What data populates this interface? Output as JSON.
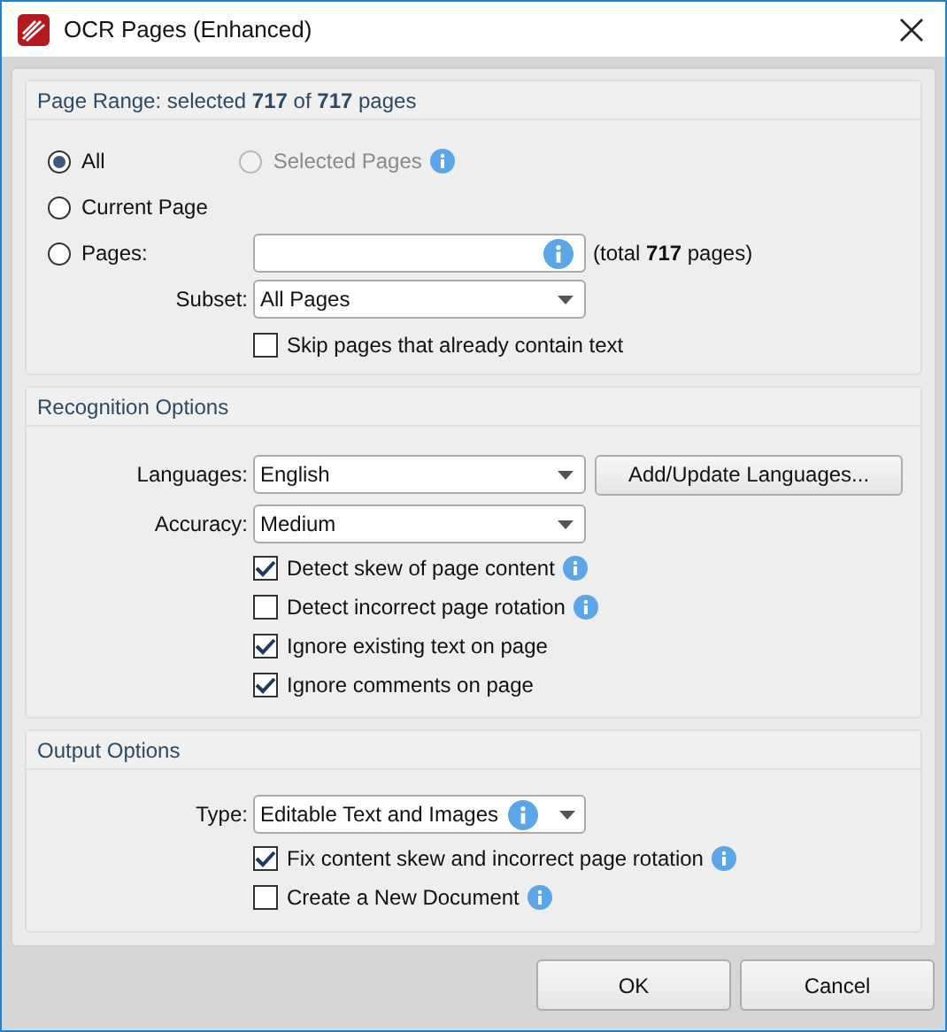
{
  "window": {
    "title": "OCR Pages (Enhanced)"
  },
  "page_range": {
    "title": "Page Range: selected **717** of **717** pages",
    "all": {
      "label": "All",
      "selected": true,
      "disabled": false
    },
    "selected_pages": {
      "label": "Selected Pages",
      "selected": false,
      "disabled": true,
      "info": true
    },
    "current_page": {
      "label": "Current Page",
      "selected": false,
      "disabled": false
    },
    "pages": {
      "label": "Pages:",
      "selected": false,
      "disabled": false,
      "info": true,
      "total": "(total **717** pages)"
    },
    "subset": {
      "label": "Subset:",
      "value": "All Pages"
    },
    "checkboxes": [
      {
        "label": "Skip pages that already contain text",
        "checked": false,
        "info": false
      }
    ]
  },
  "recognition": {
    "title": "Recognition Options",
    "languages": {
      "label": "Languages:",
      "value": "English",
      "button": "Add/Update Languages..."
    },
    "accuracy": {
      "label": "Accuracy:",
      "value": "Medium"
    },
    "checkboxes": [
      {
        "label": "Detect skew of page content",
        "checked": true,
        "info": true
      },
      {
        "label": "Detect incorrect page rotation",
        "checked": false,
        "info": true
      },
      {
        "label": "Ignore existing text on page",
        "checked": true,
        "info": false
      },
      {
        "label": "Ignore comments on page",
        "checked": true,
        "info": false
      }
    ]
  },
  "output": {
    "title": "Output Options",
    "type": {
      "label": "Type:",
      "value": "Editable Text and Images",
      "info": true
    },
    "checkboxes": [
      {
        "label": "Fix content skew and incorrect page rotation",
        "checked": true,
        "info": true
      },
      {
        "label": "Create a New Document",
        "checked": false,
        "info": true
      }
    ]
  },
  "buttons": [
    "OK",
    "Cancel"
  ]
}
